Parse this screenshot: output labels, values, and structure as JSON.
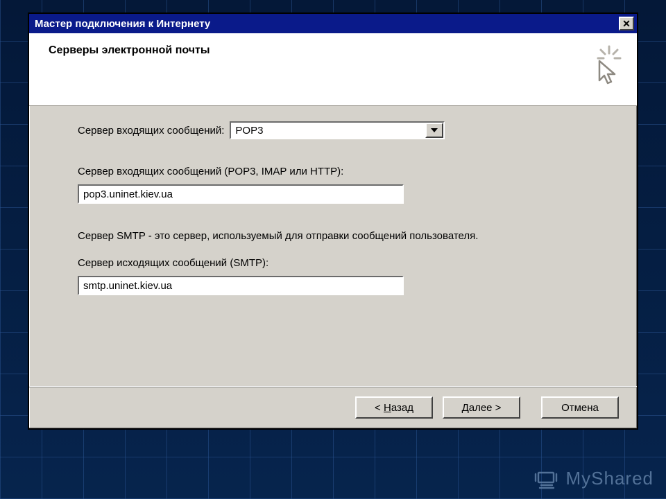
{
  "window": {
    "title": "Мастер подключения к Интернету"
  },
  "header": {
    "title": "Серверы электронной почты"
  },
  "form": {
    "incoming_type_label": "Сервер входящих сообщений:",
    "incoming_type_value": "POP3",
    "incoming_server_label": "Сервер входящих сообщений (POP3, IMAP или HTTP):",
    "incoming_server_value": "pop3.uninet.kiev.ua",
    "smtp_note": "Сервер SMTP - это сервер, используемый для отправки сообщений  пользователя.",
    "outgoing_server_label": "Сервер исходящих сообщений (SMTP):",
    "outgoing_server_value": "smtp.uninet.kiev.ua"
  },
  "buttons": {
    "back_prefix": "< ",
    "back_u": "Н",
    "back_suffix": "азад",
    "next": "Далее >",
    "cancel": "Отмена"
  },
  "watermark": {
    "text": "MyShared"
  }
}
